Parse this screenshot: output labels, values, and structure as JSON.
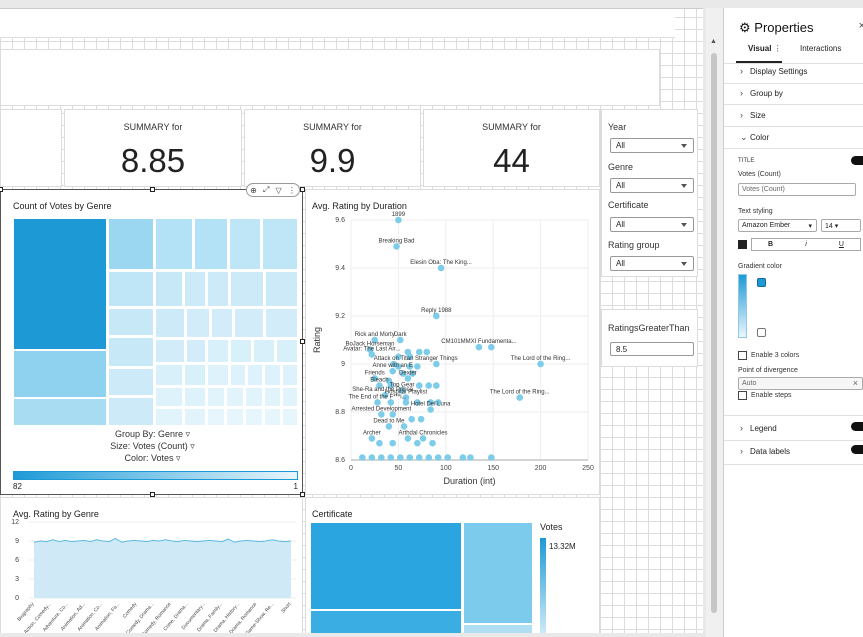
{
  "kpis": [
    {
      "label": "SUMMARY for",
      "value": "8.85"
    },
    {
      "label": "SUMMARY for",
      "value": "9.9"
    },
    {
      "label": "SUMMARY for",
      "value": "44"
    }
  ],
  "treemap1": {
    "title": "Count of Votes by Genre",
    "group_by": "Group By: Genre",
    "size": "Size: Votes (Count)",
    "color": "Color: Votes",
    "legend_min": "82",
    "legend_max": "1"
  },
  "scatter": {
    "title": "Avg. Rating by Duration",
    "xlabel": "Duration (int)",
    "ylabel": "Rating"
  },
  "chart_data": [
    {
      "type": "heatmap",
      "title": "Count of Votes by Genre",
      "legend": [
        "82",
        "1"
      ]
    },
    {
      "type": "scatter",
      "title": "Avg. Rating by Duration",
      "xlabel": "Duration (int)",
      "ylabel": "Rating",
      "xlim": [
        0,
        250
      ],
      "ylim": [
        8.6,
        9.6
      ],
      "xticks": [
        "0",
        "50",
        "100",
        "150",
        "200",
        "250"
      ],
      "yticks": [
        "8.6",
        "8.8",
        "9",
        "9.2",
        "9.4",
        "9.6"
      ],
      "points": [
        {
          "x": 50,
          "y": 9.6,
          "label": "1899"
        },
        {
          "x": 48,
          "y": 9.49,
          "label": "Breaking Bad"
        },
        {
          "x": 95,
          "y": 9.4,
          "label": "Elesin Oba: The King..."
        },
        {
          "x": 90,
          "y": 9.2,
          "label": "Reply 1988"
        },
        {
          "x": 25,
          "y": 9.1,
          "label": "Rick and Morty"
        },
        {
          "x": 52,
          "y": 9.1,
          "label": "Dark"
        },
        {
          "x": 135,
          "y": 9.07,
          "label": "CM101MMXI Fundamenta..."
        },
        {
          "x": 148,
          "y": 9.07,
          "label": ""
        },
        {
          "x": 20,
          "y": 9.06,
          "label": "BoJack Horseman"
        },
        {
          "x": 22,
          "y": 9.04,
          "label": "Avatar: The Last Air..."
        },
        {
          "x": 60,
          "y": 9.05,
          "label": ""
        },
        {
          "x": 72,
          "y": 9.05,
          "label": ""
        },
        {
          "x": 80,
          "y": 9.05,
          "label": ""
        },
        {
          "x": 50,
          "y": 9.03,
          "label": ""
        },
        {
          "x": 62,
          "y": 9.03,
          "label": ""
        },
        {
          "x": 45,
          "y": 9.0,
          "label": "Attack on Titan"
        },
        {
          "x": 90,
          "y": 9.0,
          "label": "Stranger Things"
        },
        {
          "x": 200,
          "y": 9.0,
          "label": "The Lord of the Ring..."
        },
        {
          "x": 50,
          "y": 8.99,
          "label": ""
        },
        {
          "x": 62,
          "y": 8.99,
          "label": ""
        },
        {
          "x": 70,
          "y": 8.99,
          "label": ""
        },
        {
          "x": 44,
          "y": 8.97,
          "label": "Anne with an E"
        },
        {
          "x": 55,
          "y": 8.96,
          "label": ""
        },
        {
          "x": 65,
          "y": 8.96,
          "label": ""
        },
        {
          "x": 25,
          "y": 8.94,
          "label": "Friends"
        },
        {
          "x": 60,
          "y": 8.94,
          "label": "Dexter"
        },
        {
          "x": 40,
          "y": 8.93,
          "label": ""
        },
        {
          "x": 30,
          "y": 8.91,
          "label": "Bleach"
        },
        {
          "x": 42,
          "y": 8.91,
          "label": ""
        },
        {
          "x": 72,
          "y": 8.91,
          "label": ""
        },
        {
          "x": 82,
          "y": 8.91,
          "label": ""
        },
        {
          "x": 90,
          "y": 8.91,
          "label": ""
        },
        {
          "x": 54,
          "y": 8.89,
          "label": "Top Gear"
        },
        {
          "x": 36,
          "y": 8.87,
          "label": "She-Ra and the Prince..."
        },
        {
          "x": 58,
          "y": 8.86,
          "label": "Hospital Playlist"
        },
        {
          "x": 178,
          "y": 8.86,
          "label": "The Lord of the Ring..."
        },
        {
          "x": 28,
          "y": 8.84,
          "label": "The End of the F***i..."
        },
        {
          "x": 42,
          "y": 8.84,
          "label": ""
        },
        {
          "x": 58,
          "y": 8.84,
          "label": ""
        },
        {
          "x": 70,
          "y": 8.84,
          "label": ""
        },
        {
          "x": 84,
          "y": 8.84,
          "label": ""
        },
        {
          "x": 92,
          "y": 8.84,
          "label": ""
        },
        {
          "x": 84,
          "y": 8.81,
          "label": "Hotel Del Luna"
        },
        {
          "x": 32,
          "y": 8.79,
          "label": "Arrested Development"
        },
        {
          "x": 44,
          "y": 8.79,
          "label": ""
        },
        {
          "x": 64,
          "y": 8.77,
          "label": ""
        },
        {
          "x": 74,
          "y": 8.77,
          "label": ""
        },
        {
          "x": 40,
          "y": 8.74,
          "label": "Dead to Me"
        },
        {
          "x": 56,
          "y": 8.74,
          "label": ""
        },
        {
          "x": 22,
          "y": 8.69,
          "label": "Archer"
        },
        {
          "x": 76,
          "y": 8.69,
          "label": "Arthdal Chronicles"
        },
        {
          "x": 60,
          "y": 8.69,
          "label": ""
        },
        {
          "x": 30,
          "y": 8.67,
          "label": ""
        },
        {
          "x": 44,
          "y": 8.67,
          "label": ""
        },
        {
          "x": 70,
          "y": 8.67,
          "label": ""
        },
        {
          "x": 86,
          "y": 8.67,
          "label": ""
        },
        {
          "x": 12,
          "y": 8.61,
          "label": ""
        },
        {
          "x": 22,
          "y": 8.61,
          "label": ""
        },
        {
          "x": 32,
          "y": 8.61,
          "label": ""
        },
        {
          "x": 42,
          "y": 8.61,
          "label": ""
        },
        {
          "x": 52,
          "y": 8.61,
          "label": ""
        },
        {
          "x": 62,
          "y": 8.61,
          "label": ""
        },
        {
          "x": 72,
          "y": 8.61,
          "label": ""
        },
        {
          "x": 82,
          "y": 8.61,
          "label": ""
        },
        {
          "x": 92,
          "y": 8.61,
          "label": ""
        },
        {
          "x": 102,
          "y": 8.61,
          "label": ""
        },
        {
          "x": 118,
          "y": 8.61,
          "label": ""
        },
        {
          "x": 126,
          "y": 8.61,
          "label": ""
        },
        {
          "x": 148,
          "y": 8.61,
          "label": ""
        }
      ]
    },
    {
      "type": "area",
      "title": "Avg. Rating by Genre",
      "yticks": [
        "12",
        "9",
        "6",
        "3",
        "0"
      ],
      "categories": [
        "Biography",
        "Action, Comedy...",
        "Adventure, Co...",
        "Animation, Ad...",
        "Animation, Co...",
        "Animation, Fa...",
        "Comedy",
        "Comedy, Drama...",
        "Comedy, Romance",
        "Crime, Drama...",
        "Documentary...",
        "Drama, Family...",
        "Drama, History...",
        "Drama, Romance",
        "Game-Show, Re...",
        "Short"
      ],
      "values": [
        8.8,
        9.0,
        8.9,
        9.2,
        8.9,
        9.1,
        8.9,
        9.0,
        9.1,
        8.9,
        9.2,
        9.0,
        8.9,
        9.4,
        8.8,
        9.0,
        9.1,
        9.0,
        8.9,
        9.1,
        9.0,
        9.2,
        9.0,
        8.9,
        9.1,
        9.0,
        8.9,
        9.0,
        9.1,
        9.0,
        8.9,
        9.3,
        8.8,
        9.0,
        9.1,
        9.0,
        8.9,
        9.0,
        9.2,
        9.0,
        8.9,
        9.0
      ]
    },
    {
      "type": "heatmap",
      "title": "Certificate",
      "legend_title": "Votes",
      "legend_max": "13.32M"
    }
  ],
  "certificate": {
    "title": "Certificate",
    "legend_title": "Votes",
    "legend_max": "13.32M"
  },
  "genre_chart": {
    "title": "Avg. Rating by Genre"
  },
  "filters": {
    "year": {
      "label": "Year",
      "value": "All"
    },
    "genre": {
      "label": "Genre",
      "value": "All"
    },
    "certificate": {
      "label": "Certificate",
      "value": "All"
    },
    "rating_group": {
      "label": "Rating group",
      "value": "All"
    }
  },
  "ratings_filter": {
    "label": "RatingsGreaterThan",
    "value": "8.5"
  },
  "panel": {
    "title": "Properties",
    "close": "×",
    "tabs": [
      "Visual",
      "Interactions"
    ],
    "sections": [
      "Display Settings",
      "Group by",
      "Size",
      "Color"
    ],
    "color": {
      "title_label": "TITLE",
      "votes_label": "Votes (Count)",
      "votes_placeholder": "Votes (Count)",
      "text_styling": "Text styling",
      "font": "Amazon Ember",
      "size": "14",
      "bold": "B",
      "italic": "i",
      "underline": "U",
      "gradient_label": "Gradient color",
      "enable3": "Enable 3 colors",
      "divergence": "Point of divergence",
      "auto": "Auto",
      "clear": "×",
      "steps": "Enable steps"
    },
    "bottom_sections": [
      "Legend",
      "Data labels"
    ]
  },
  "toolbar_icons": [
    "focus-icon",
    "expand-icon",
    "filter-icon",
    "more-icon"
  ]
}
